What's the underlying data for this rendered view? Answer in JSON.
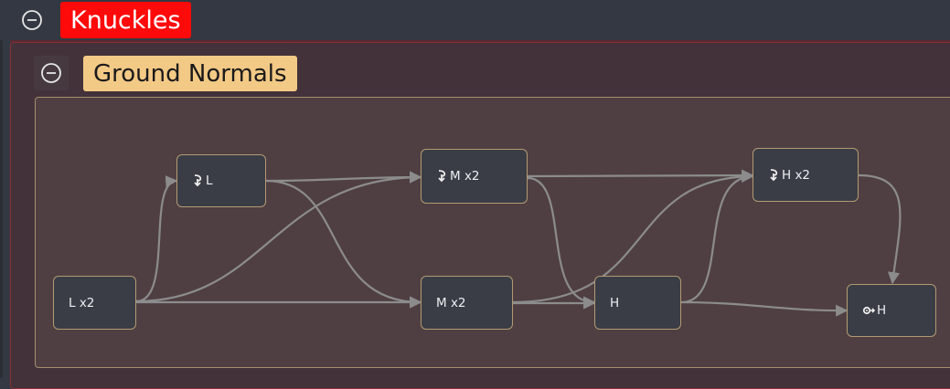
{
  "outer_group": {
    "title": "Knuckles",
    "title_color": "#ff0a0a"
  },
  "inner_group": {
    "title": "Ground Normals",
    "title_color": "#f3c986"
  },
  "nodes": {
    "l": {
      "label": "L",
      "icon": "fall-arrow-icon"
    },
    "mx2_top": {
      "label": "M x2",
      "icon": "fall-arrow-icon"
    },
    "hx2_top": {
      "label": "H x2",
      "icon": "fall-arrow-icon"
    },
    "lx2": {
      "label": "L x2"
    },
    "mx2": {
      "label": "M x2"
    },
    "h": {
      "label": "H"
    },
    "h_out": {
      "label": "H",
      "icon": "gear-arrow-icon"
    }
  },
  "colors": {
    "edge": "#8c8c8c",
    "node_border": "#b39a72",
    "node_bg": "#3a3d45"
  }
}
